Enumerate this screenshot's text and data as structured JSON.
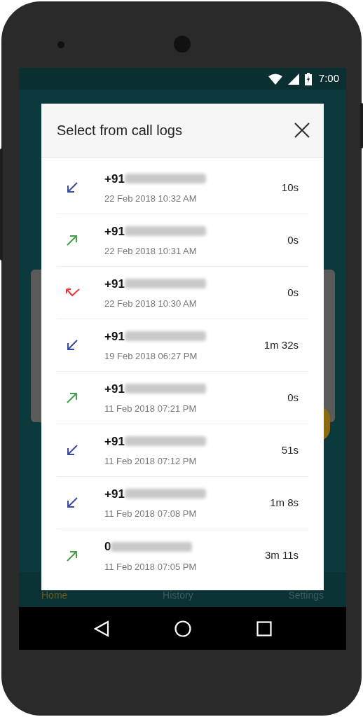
{
  "status_bar": {
    "time": "7:00"
  },
  "dialog": {
    "title": "Select from call logs",
    "calls": [
      {
        "kind": "incoming",
        "number": "+91",
        "date": "22 Feb 2018 10:32 AM",
        "duration": "10s"
      },
      {
        "kind": "outgoing",
        "number": "+91",
        "date": "22 Feb 2018 10:31 AM",
        "duration": "0s"
      },
      {
        "kind": "missed",
        "number": "+91",
        "date": "22 Feb 2018 10:30 AM",
        "duration": "0s"
      },
      {
        "kind": "incoming",
        "number": "+91",
        "date": "19 Feb 2018 06:27 PM",
        "duration": "1m 32s"
      },
      {
        "kind": "outgoing",
        "number": "+91",
        "date": "11 Feb 2018 07:21 PM",
        "duration": "0s"
      },
      {
        "kind": "incoming",
        "number": "+91",
        "date": "11 Feb 2018 07:12 PM",
        "duration": "51s"
      },
      {
        "kind": "incoming",
        "number": "+91",
        "date": "11 Feb 2018 07:08 PM",
        "duration": "1m 8s"
      },
      {
        "kind": "outgoing",
        "number": "0",
        "date": "11 Feb 2018 07:05 PM",
        "duration": "3m 11s"
      }
    ]
  },
  "bottom_nav": [
    {
      "label": "Home",
      "selected": true
    },
    {
      "label": "History",
      "selected": false
    },
    {
      "label": "Settings",
      "selected": false
    }
  ]
}
